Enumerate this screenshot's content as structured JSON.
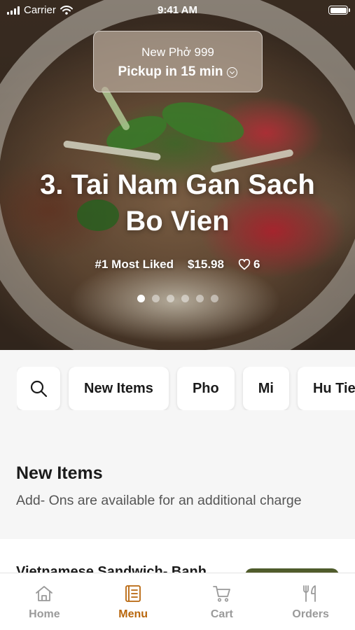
{
  "status_bar": {
    "carrier": "Carrier",
    "time": "9:41 AM"
  },
  "pickup": {
    "store": "New Phở 999",
    "time_label": "Pickup in 15 min"
  },
  "hero": {
    "title_line1": "3. Tai Nam Gan Sach",
    "title_line2": "Bo Vien",
    "rank": "#1 Most Liked",
    "price": "$15.98",
    "likes": "6",
    "slide_count": 6,
    "active_slide": 1
  },
  "categories": [
    "New Items",
    "Pho",
    "Mi",
    "Hu Tieu"
  ],
  "section": {
    "title": "New Items",
    "subtitle": "Add- Ons are available for an additional charge"
  },
  "item": {
    "name": "Vietnamese Sandwich- Banh"
  },
  "tabs": [
    {
      "label": "Home",
      "icon": "home-icon",
      "active": false
    },
    {
      "label": "Menu",
      "icon": "menu-book-icon",
      "active": true
    },
    {
      "label": "Cart",
      "icon": "cart-icon",
      "active": false
    },
    {
      "label": "Orders",
      "icon": "fork-knife-icon",
      "active": false
    }
  ],
  "colors": {
    "accent": "#b8660c",
    "tab_inactive": "#9a9a9a",
    "background": "#f6f6f6"
  }
}
